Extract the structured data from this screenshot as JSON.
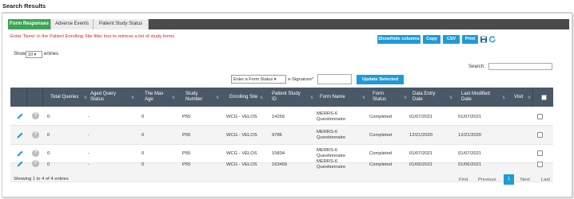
{
  "page": {
    "title": "Search Results"
  },
  "tabs": [
    {
      "label": "Form Responses",
      "active": true
    },
    {
      "label": "Adverse Events",
      "active": false
    },
    {
      "label": "Patient Study Status",
      "active": false
    }
  ],
  "notice": "Enter 'None' in the Patient Enrolling Site filter box to retrieve a list of study forms",
  "toolbar": {
    "show_hide_label": "Show/hide columns",
    "copy_label": "Copy",
    "csv_label": "CSV",
    "print_label": "Print",
    "save_icon": "save-icon",
    "refresh_icon": "refresh-icon"
  },
  "length": {
    "show_label": "Show",
    "value": "10",
    "entries_label": "entries"
  },
  "search": {
    "label": "Search:",
    "value": ""
  },
  "bulk": {
    "status_select": "Enter a Form Status",
    "esignature_label": "e-Signature*",
    "esignature_value": "",
    "update_label": "Update Selected"
  },
  "table": {
    "columns": [
      "Total Queries",
      "Aged Query Status",
      "The Max Age",
      "Study Number",
      "Enrolling Site",
      "Patient Study ID",
      "Form Name",
      "Form Status",
      "Data Entry Date",
      "Last Modified Date",
      "Visit"
    ],
    "rows": [
      {
        "total_queries": "0",
        "aged": "-",
        "max_age": "0",
        "study": "P55",
        "site": "WCG - VELOS",
        "patient_id": "14256",
        "form": "MERRS-6 Questionnaire",
        "status": "Completed",
        "entry_date": "01/07/2021",
        "modified": "01/07/2021",
        "visit": ""
      },
      {
        "total_queries": "0",
        "aged": "-",
        "max_age": "0",
        "study": "P55",
        "site": "WCG - VELOS",
        "patient_id": "9786",
        "form": "MERRS-6 Questionnaire",
        "status": "Completed",
        "entry_date": "12/21/2020",
        "modified": "12/21/2020",
        "visit": ""
      },
      {
        "total_queries": "0",
        "aged": "-",
        "max_age": "0",
        "study": "P55",
        "site": "WCG - VELOS",
        "patient_id": "15834",
        "form": "MERRS-6 Questionnaire",
        "status": "Completed",
        "entry_date": "01/07/2021",
        "modified": "01/07/2021",
        "visit": ""
      },
      {
        "total_queries": "0",
        "aged": "-",
        "max_age": "0",
        "study": "P55",
        "site": "WCG - VELOS",
        "patient_id": "163455",
        "form": "MERRS-6 Questionnaire",
        "status": "Completed",
        "entry_date": "01/06/2021",
        "modified": "01/06/2021",
        "visit": ""
      }
    ]
  },
  "footer": {
    "info": "Showing 1 to 4 of 4 entries",
    "first": "First",
    "previous": "Previous",
    "current": "1",
    "next": "Next",
    "last": "Last"
  },
  "colors": {
    "accent": "#1e9bd7",
    "tab_active": "#3aa655",
    "header": "#4a5867",
    "notice": "#e02020"
  }
}
